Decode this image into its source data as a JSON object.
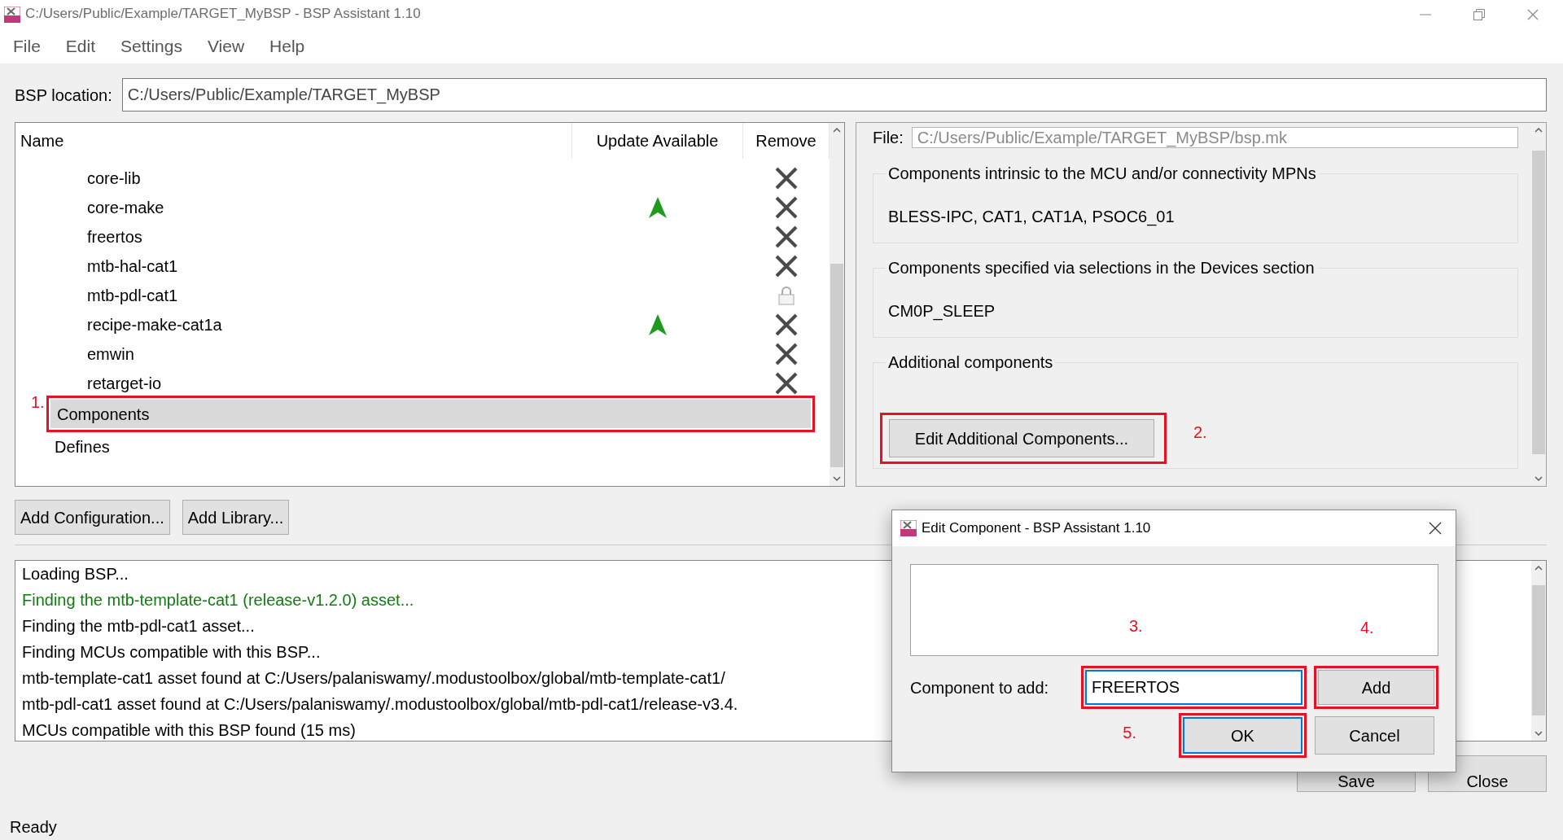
{
  "window": {
    "title": "C:/Users/Public/Example/TARGET_MyBSP - BSP Assistant 1.10"
  },
  "menu": [
    "File",
    "Edit",
    "Settings",
    "View",
    "Help"
  ],
  "bsp_location": {
    "label": "BSP location:",
    "value": "C:/Users/Public/Example/TARGET_MyBSP"
  },
  "tree": {
    "columns": [
      "Name",
      "Update Available",
      "Remove"
    ],
    "items": [
      {
        "children": [
          {
            "name": "core-lib",
            "update_available": false,
            "kind": "removable",
            "selected": false
          },
          {
            "name": "core-make",
            "update_available": true,
            "kind": "removable",
            "selected": false
          },
          {
            "name": "freertos",
            "update_available": false,
            "kind": "removable",
            "selected": false
          },
          {
            "name": "mtb-hal-cat1",
            "update_available": false,
            "kind": "removable",
            "selected": false
          },
          {
            "name": "mtb-pdl-cat1",
            "update_available": false,
            "kind": "locked",
            "selected": false
          },
          {
            "name": "recipe-make-cat1a",
            "update_available": true,
            "kind": "removable",
            "selected": false
          },
          {
            "name": "emwin",
            "update_available": false,
            "kind": "removable",
            "selected": false
          },
          {
            "name": "retarget-io",
            "update_available": false,
            "kind": "removable",
            "selected": false
          }
        ]
      },
      {
        "name": "Components",
        "selected": true,
        "callout": "1."
      },
      {
        "name": "Defines",
        "selected": false
      }
    ]
  },
  "details": {
    "file": {
      "label": "File:",
      "value": "C:/Users/Public/Example/TARGET_MyBSP/bsp.mk",
      "disabled": true
    },
    "groups": [
      {
        "title": "Components intrinsic to the MCU and/or connectivity MPNs",
        "value": "BLESS-IPC, CAT1, CAT1A, PSOC6_01"
      },
      {
        "title": "Components specified via selections in the Devices section",
        "value": "CM0P_SLEEP"
      },
      {
        "title": "Additional components",
        "button": {
          "label": "Edit Additional Components...",
          "callout": "2."
        }
      }
    ]
  },
  "actions": [
    "Add Configuration...",
    "Add Library..."
  ],
  "log": [
    {
      "text": "Loading BSP...",
      "color": "#000000"
    },
    {
      "text": "Finding the mtb-template-cat1 (release-v1.2.0) asset...",
      "color": "#107c10"
    },
    {
      "text": "Finding the mtb-pdl-cat1 asset...",
      "color": "#000000"
    },
    {
      "text": "Finding MCUs compatible with this BSP...",
      "color": "#000000"
    },
    {
      "text": "mtb-template-cat1 asset found at C:/Users/palaniswamy/.modustoolbox/global/mtb-template-cat1/",
      "color": "#000000"
    },
    {
      "text": "mtb-pdl-cat1 asset found at C:/Users/palaniswamy/.modustoolbox/global/mtb-pdl-cat1/release-v3.4.",
      "color": "#000000"
    },
    {
      "text": "MCUs compatible with this BSP found (15 ms)",
      "color": "#000000"
    }
  ],
  "footer_buttons": [
    "Save",
    "Close"
  ],
  "status_bar": "Ready",
  "dialog": {
    "title": "Edit Component - BSP Assistant 1.10",
    "label": "Component to add:",
    "field": {
      "value": "FREERTOS",
      "focused": true,
      "callout": "3."
    },
    "add_button": {
      "label": "Add",
      "callout": "4.",
      "default": false
    },
    "buttons": [
      {
        "label": "OK",
        "callout": "5.",
        "default": true
      },
      {
        "label": "Cancel",
        "default": false
      }
    ]
  }
}
